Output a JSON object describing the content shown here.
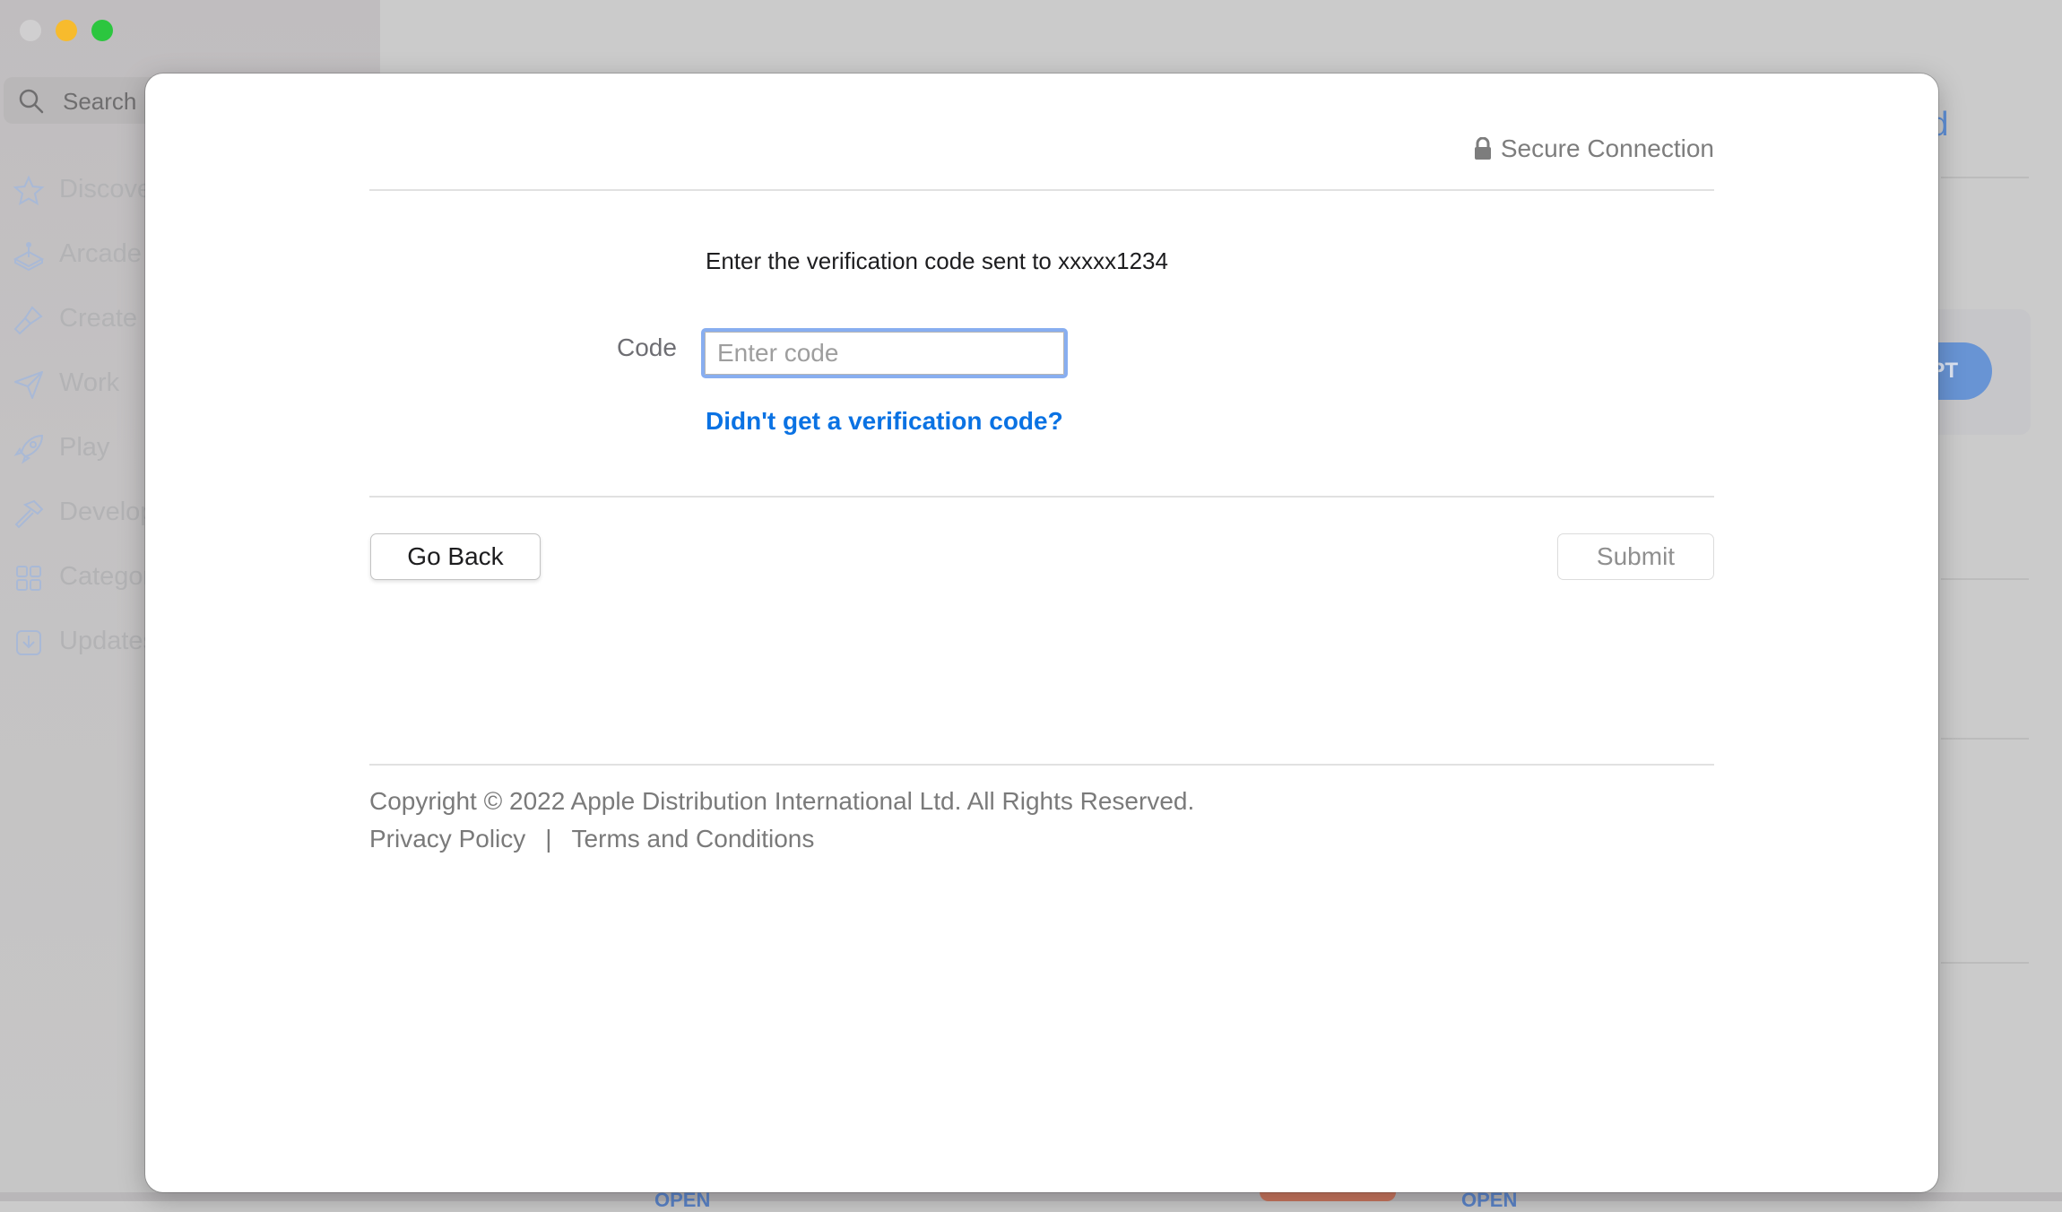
{
  "window": {
    "traffic_lights": [
      "close",
      "minimize",
      "maximize"
    ]
  },
  "sidebar": {
    "search_label": "Search",
    "items": [
      {
        "label": "Discover",
        "icon": "star-icon"
      },
      {
        "label": "Arcade",
        "icon": "joystick-icon"
      },
      {
        "label": "Create",
        "icon": "paintbrush-icon"
      },
      {
        "label": "Work",
        "icon": "paper-plane-icon"
      },
      {
        "label": "Play",
        "icon": "rocket-icon"
      },
      {
        "label": "Develop",
        "icon": "hammer-icon"
      },
      {
        "label": "Categories",
        "icon": "grid-icon"
      },
      {
        "label": "Updates",
        "icon": "download-icon"
      }
    ]
  },
  "background": {
    "title_fragment": "t Card",
    "pill_fragment": "PT",
    "open_buttons": [
      "OPEN",
      "OPEN"
    ]
  },
  "modal": {
    "secure_label": "Secure Connection",
    "instructions": "Enter the verification code sent to xxxxx1234",
    "code_label": "Code",
    "code_value": "",
    "code_placeholder": "Enter code",
    "resend_link": "Didn't get a verification code?",
    "go_back_label": "Go Back",
    "submit_label": "Submit",
    "submit_disabled": true,
    "copyright": "Copyright © 2022 Apple Distribution International Ltd. All Rights Reserved.",
    "privacy_link": "Privacy Policy",
    "link_separator": "|",
    "terms_link": "Terms and Conditions"
  },
  "colors": {
    "link_blue": "#0a72e3",
    "focus_ring": "#88aef0",
    "traffic_minimize": "#f7bb2d",
    "traffic_maximize": "#2cc63f"
  }
}
